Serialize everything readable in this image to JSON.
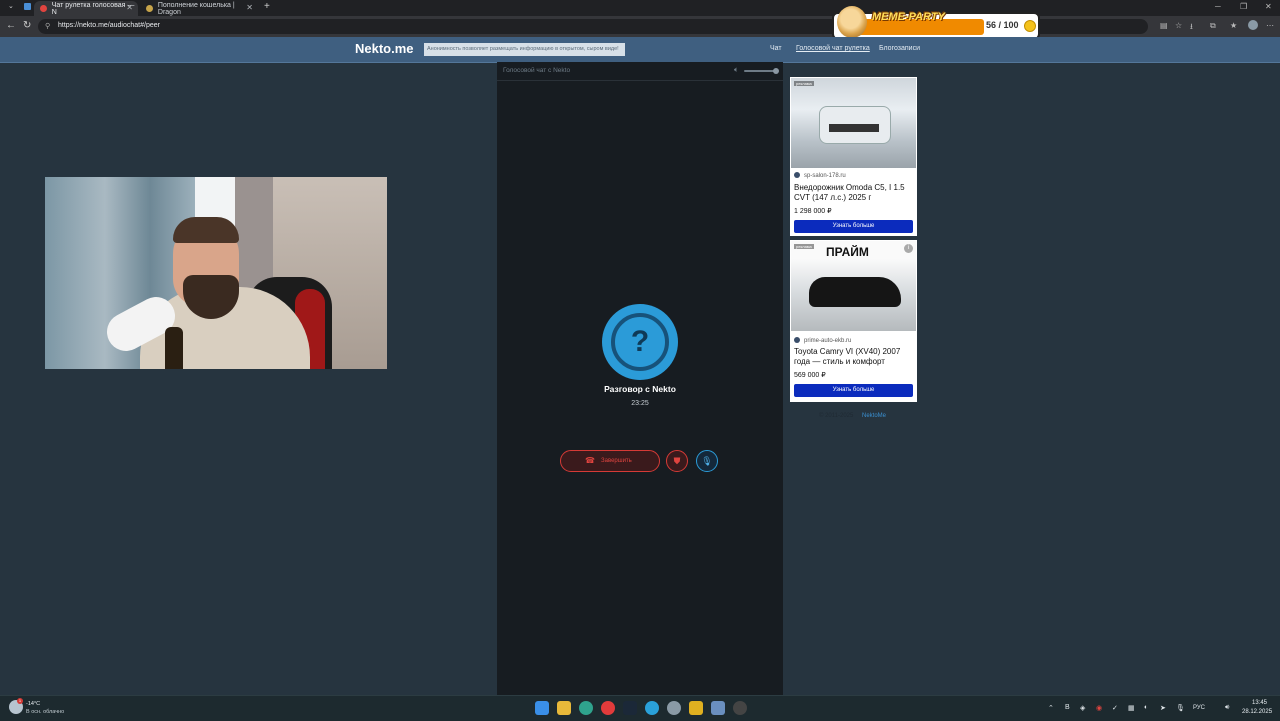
{
  "browser": {
    "tabs": [
      {
        "title": "Чат рулетка голосовая — N"
      },
      {
        "title": "Пополнение кошелька | Dragon"
      }
    ],
    "new_tab_symbol": "+",
    "url": "https://nekto.me/audiochat#/peer"
  },
  "overlay": {
    "title": "MEME-PARTY",
    "count": "56 / 100"
  },
  "site": {
    "logo": "Nekto.me",
    "notice": "Анонимность позволяет размещать информацию в открытом, сыром виде!",
    "nav": [
      {
        "label": "Чат"
      },
      {
        "label": "Голосовой чат рулетка"
      },
      {
        "label": "Блогозаписи"
      }
    ]
  },
  "chat": {
    "header_title": "Голосовой чат с Nekto",
    "avatar_symbol": "?",
    "peer_name": "Разговор с Nekto",
    "timer": "23:25",
    "end_label": "Завершить"
  },
  "ads": [
    {
      "tag": "реклама",
      "domain": "sp-salon-178.ru",
      "title": "Внедорожник Omoda C5, I 1.5 CVT (147 л.с.) 2025 г",
      "price": "1 298 000 ₽",
      "button": "Узнать больше"
    },
    {
      "tag": "реклама",
      "brand": "ПРАЙМ",
      "domain": "prime-auto-ekb.ru",
      "title": "Toyota Camry VI (XV40) 2007 года — стиль и комфорт",
      "price": "569 000 ₽",
      "button": "Узнать больше"
    }
  ],
  "footer": {
    "text": "© 2011-2025",
    "link": "NektoMe"
  },
  "taskbar": {
    "weather_temp": "-14°C",
    "weather_desc": "В осн. облачно",
    "weather_badge": "1",
    "lang": "РУС",
    "time": "13:45",
    "date": "28.12.2025"
  }
}
